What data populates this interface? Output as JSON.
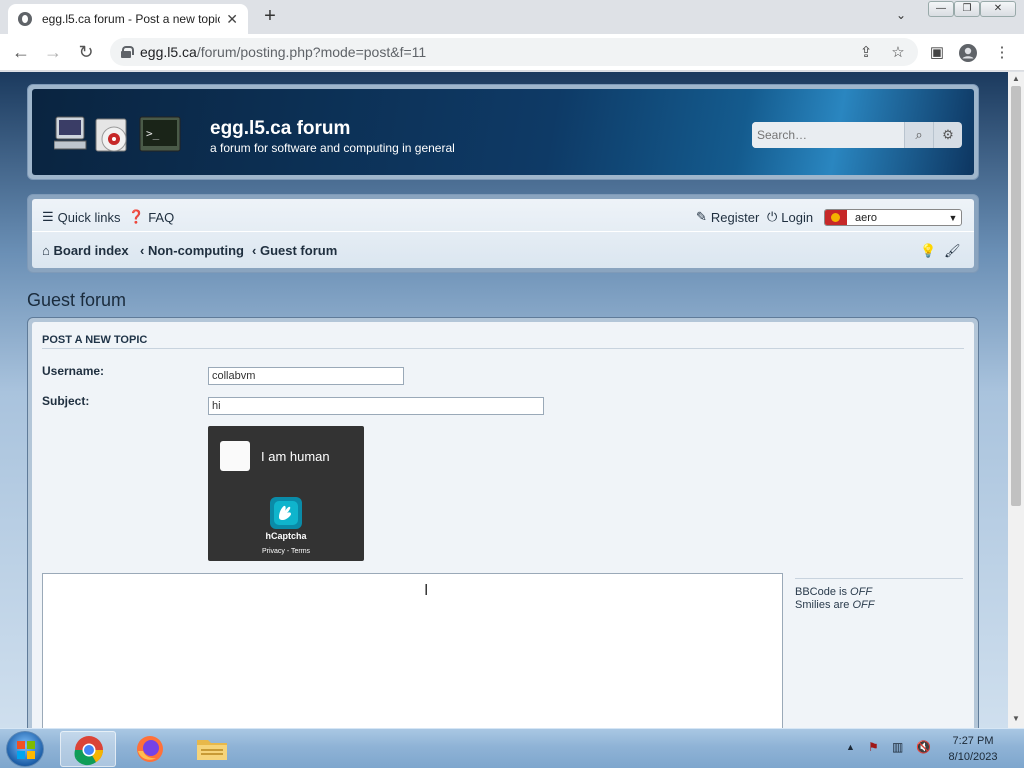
{
  "browser": {
    "tab_title": "egg.l5.ca forum - Post a new topic",
    "tab_close": "✕",
    "new_tab": "+",
    "tab_search": "⌄",
    "window_controls": {
      "minimize": "—",
      "maximize": "❐",
      "close": "✕"
    },
    "url_host": "egg.l5.ca",
    "url_path": "/forum/posting.php?mode=post&f=11"
  },
  "header": {
    "site_title": "egg.l5.ca forum",
    "site_description": "a forum for software and computing in general",
    "search_placeholder": "Search…"
  },
  "navbar": {
    "quick_links": "Quick links",
    "faq": "FAQ",
    "register": "Register",
    "login": "Login",
    "style_value": "aero",
    "breadcrumbs": [
      "Board index",
      "Non-computing",
      "Guest forum"
    ]
  },
  "page": {
    "title": "Guest forum"
  },
  "form": {
    "panel_title": "Post a new topic",
    "username_label": "Username:",
    "username_value": "collabvm",
    "subject_label": "Subject:",
    "subject_value": "hi",
    "captcha": {
      "label": "I am human",
      "brand": "hCaptcha",
      "links": "Privacy - Terms"
    },
    "bbcode_text": "BBCode is",
    "bbcode_status": "OFF",
    "smilies_text": "Smilies are",
    "smilies_status": "OFF"
  },
  "taskbar": {
    "time": "7:27 PM",
    "date": "8/10/2023"
  },
  "colors": {
    "accent": "#0e3a66",
    "text": "#1f2f3f",
    "taskbar": "#8fb3d6"
  }
}
